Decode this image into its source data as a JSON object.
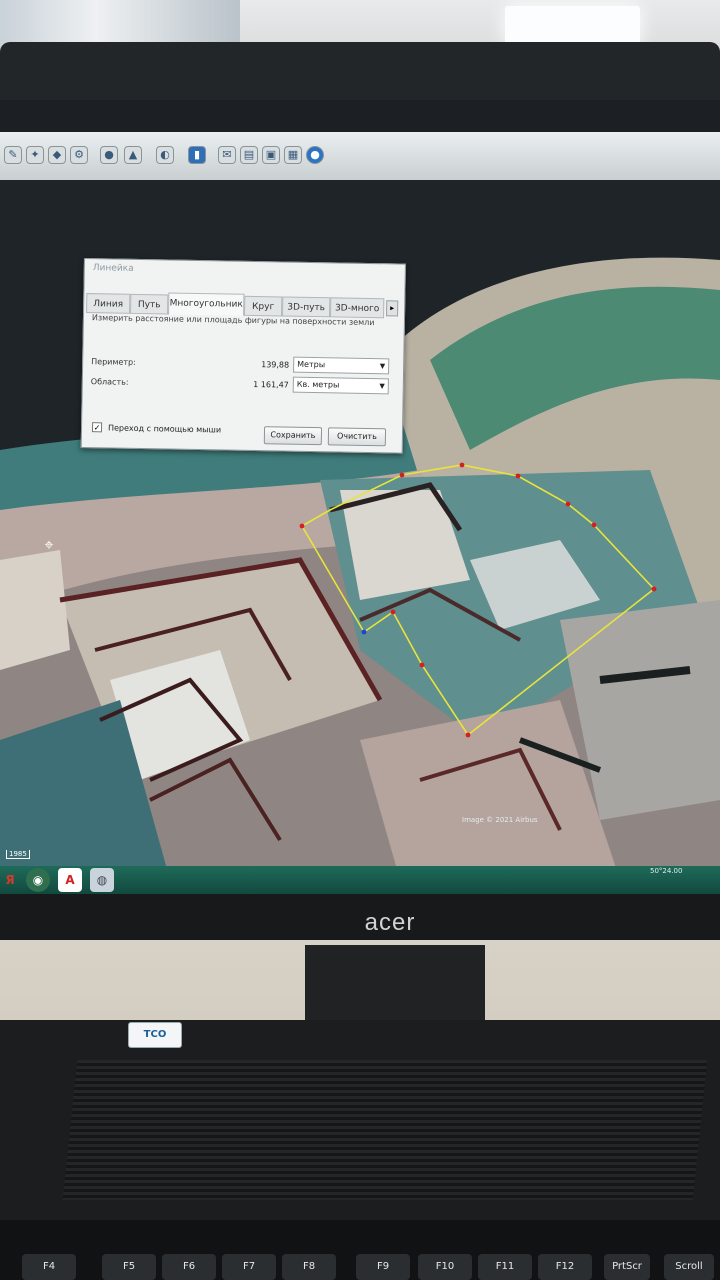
{
  "app": {
    "window_title": "Линейка"
  },
  "ruler_dialog": {
    "title": "Линейка",
    "tabs": [
      {
        "label": "Линия",
        "active": false
      },
      {
        "label": "Путь",
        "active": false
      },
      {
        "label": "Многоугольник",
        "active": true
      },
      {
        "label": "Круг",
        "active": false
      },
      {
        "label": "3D-путь",
        "active": false
      },
      {
        "label": "3D-много",
        "active": false
      }
    ],
    "tabs_more": "▸",
    "description": "Измерить расстояние или площадь фигуры на поверхности земли",
    "perimeter": {
      "label": "Периметр:",
      "value": "139,88",
      "unit": "Метры"
    },
    "area": {
      "label": "Область:",
      "value": "1 161,47",
      "unit": "Кв. метры"
    },
    "mouse_nav": {
      "label": "Переход с помощью мыши",
      "checked": true,
      "check_glyph": "✓"
    },
    "save_button": "Сохранить",
    "clear_button": "Очистить"
  },
  "map": {
    "credit": "Image © 2021 Airbus",
    "coords": "50°24.00",
    "scale": "1985",
    "polygon_color": "#e8e43a",
    "vertex_color": "#d42020"
  },
  "taskbar": {
    "icons": [
      {
        "name": "yandex-icon",
        "glyph": "Я",
        "color": "#d63a2a"
      },
      {
        "name": "chrome-icon",
        "glyph": "◉",
        "color": "#3b8d3b"
      },
      {
        "name": "acrobat-icon",
        "glyph": "A",
        "color": "#d12323"
      },
      {
        "name": "google-earth-icon",
        "glyph": "◍",
        "color": "#6a7f96"
      }
    ]
  },
  "monitor": {
    "brand": "acer",
    "sticker": "TCO"
  },
  "keyboard": {
    "keys": [
      "F4",
      "F5",
      "F6",
      "F7",
      "F8",
      "F9",
      "F10",
      "F11",
      "F12",
      "PrtScr",
      "Scroll"
    ]
  }
}
